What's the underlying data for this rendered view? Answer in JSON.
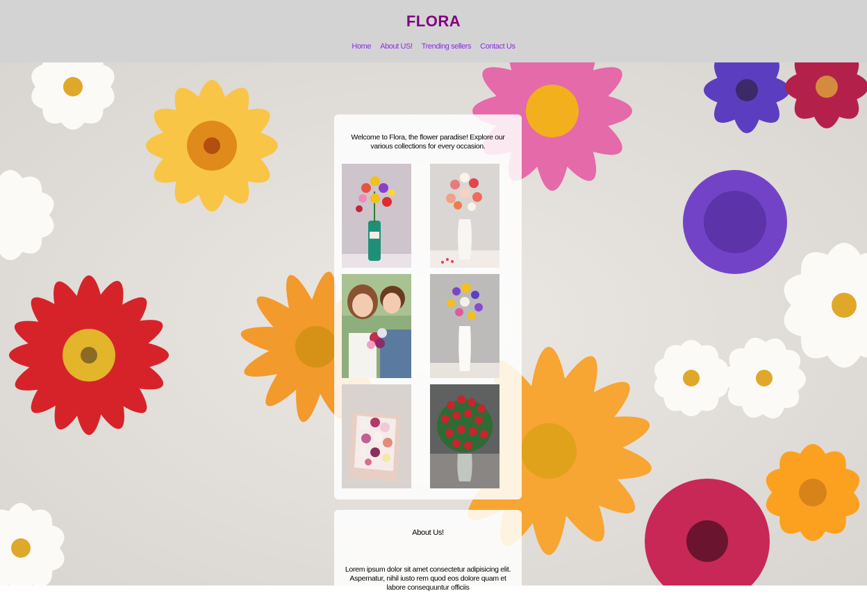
{
  "header": {
    "brand": "FLORA",
    "nav": [
      "Home",
      "About US!",
      "Trending sellers",
      "Contact Us"
    ]
  },
  "intro": {
    "text": "Welcome to Flora, the flower paradise! Explore our various collections for every occasion."
  },
  "gallery": [
    {
      "icon": "birthday-bouquet-photo"
    },
    {
      "icon": "valentine-vase-photo"
    },
    {
      "icon": "couple-bouquet-photo"
    },
    {
      "icon": "mixed-bouquet-vase-photo"
    },
    {
      "icon": "flower-box-photo"
    },
    {
      "icon": "red-roses-photo"
    }
  ],
  "about": {
    "title": "About Us!",
    "text": "Lorem ipsum dolor sit amet consectetur adipisicing elit. Aspernatur, nihil iusto rem quod eos dolore quam et labore consequuntur officiis"
  },
  "colors": {
    "header_bg": "#d3d3d3",
    "brand": "#800080",
    "nav_link": "#8a2be2"
  }
}
